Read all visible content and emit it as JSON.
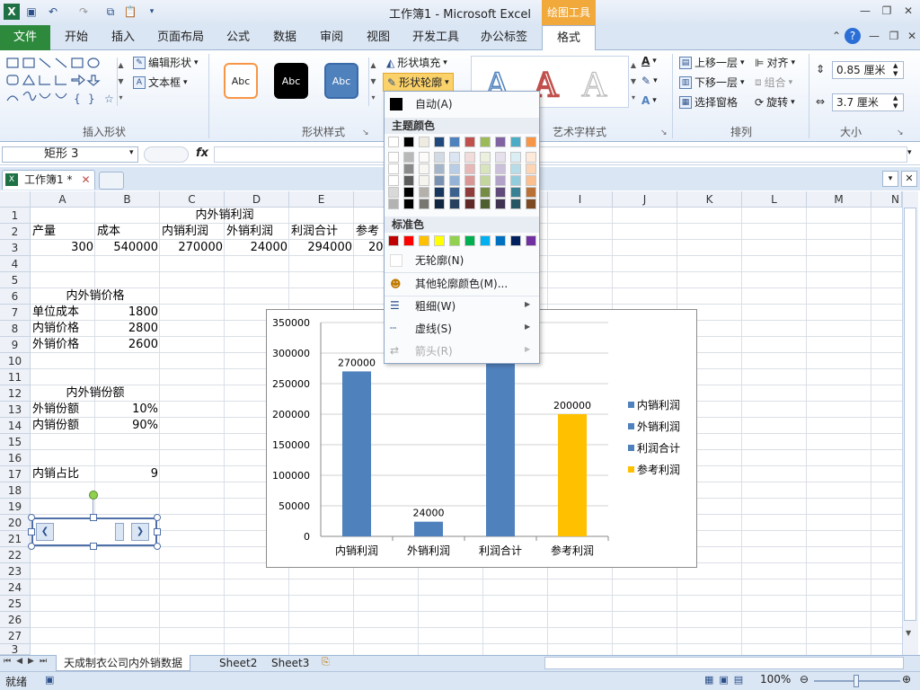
{
  "titlebar": {
    "title": "工作簿1 - Microsoft Excel",
    "context_tool": "绘图工具"
  },
  "tabs": {
    "file": "文件",
    "start": "开始",
    "insert": "插入",
    "layout": "页面布局",
    "formula": "公式",
    "data": "数据",
    "review": "审阅",
    "view": "视图",
    "developer": "开发工具",
    "office": "办公标签",
    "format": "格式"
  },
  "ribbon": {
    "edit_shape": "编辑形状",
    "textbox": "文本框",
    "group_insert": "插入形状",
    "style_abc": "Abc",
    "group_style": "形状样式",
    "fill": "形状填充",
    "outline": "形状轮廓",
    "group_art": "艺术字样式",
    "bring_forward": "上移一层",
    "send_backward": "下移一层",
    "selection_pane": "选择窗格",
    "align": "对齐",
    "group": "组合",
    "rotate": "旋转",
    "group_arrange": "排列",
    "height": "0.85 厘米",
    "width": "3.7 厘米",
    "group_size": "大小"
  },
  "formula_bar": {
    "namebox": "矩形 3",
    "fx": "fx"
  },
  "workbook_tab": "工作簿1 *",
  "columns": [
    "A",
    "B",
    "C",
    "D",
    "E",
    "F",
    "G",
    "H",
    "I",
    "J",
    "K",
    "L",
    "M",
    "N"
  ],
  "rows": [
    "1",
    "2",
    "3",
    "4",
    "5",
    "6",
    "7",
    "8",
    "9",
    "10",
    "11",
    "12",
    "13",
    "14",
    "15",
    "16",
    "17",
    "18",
    "19",
    "20",
    "21",
    "22",
    "23",
    "24",
    "25",
    "26",
    "27",
    "3"
  ],
  "cells": {
    "c1": "内外销利润",
    "a2": "产量",
    "b2": "成本",
    "c2": "内销利润",
    "d2": "外销利润",
    "e2": "利润合计",
    "f2": "参考",
    "a3": "300",
    "b3": "540000",
    "c3": "270000",
    "d3": "24000",
    "e3": "294000",
    "f3": "20",
    "a6": "内外销价格",
    "a7": "单位成本",
    "b7": "1800",
    "a8": "内销价格",
    "b8": "2800",
    "a9": "外销价格",
    "b9": "2600",
    "a12": "内外销份额",
    "a13": "外销份额",
    "b13": "10%",
    "a14": "内销份额",
    "b14": "90%",
    "a17": "内销占比",
    "b17": "9"
  },
  "chart_data": {
    "type": "bar",
    "categories": [
      "内销利润",
      "外销利润",
      "利润合计",
      "参考利润"
    ],
    "values": [
      270000,
      24000,
      294000,
      200000
    ],
    "data_labels": [
      "270000",
      "24000",
      "",
      "200000"
    ],
    "colors": [
      "#4f81bd",
      "#4f81bd",
      "#4f81bd",
      "#ffc000"
    ],
    "ylim": [
      0,
      350000
    ],
    "yticks": [
      "0",
      "50000",
      "100000",
      "150000",
      "200000",
      "250000",
      "300000",
      "350000"
    ],
    "legend": [
      "内销利润",
      "外销利润",
      "利润合计",
      "参考利润"
    ],
    "legend_position": "right",
    "grid": true
  },
  "dropdown": {
    "auto": "自动(A)",
    "theme_colors": "主题颜色",
    "standard_colors": "标准色",
    "no_outline": "无轮廓(N)",
    "more_colors": "其他轮廓颜色(M)...",
    "weight": "粗细(W)",
    "dashes": "虚线(S)",
    "arrows": "箭头(R)",
    "theme_top": [
      "#ffffff",
      "#000000",
      "#eeece1",
      "#1f497d",
      "#4f81bd",
      "#c0504d",
      "#9bbb59",
      "#8064a2",
      "#4bacc6",
      "#f79646"
    ],
    "standard": [
      "#c00000",
      "#ff0000",
      "#ffc000",
      "#ffff00",
      "#92d050",
      "#00b050",
      "#00b0f0",
      "#0070c0",
      "#002060",
      "#7030a0"
    ]
  },
  "sheets": [
    "天成制衣公司内外销数据",
    "Sheet2",
    "Sheet3"
  ],
  "status": {
    "ready": "就绪",
    "zoom": "100%"
  }
}
